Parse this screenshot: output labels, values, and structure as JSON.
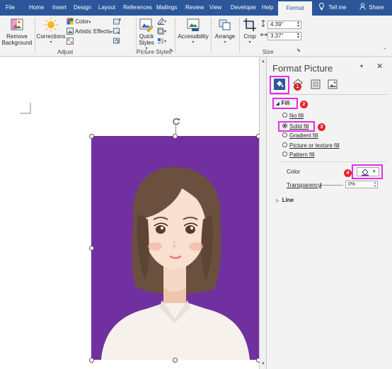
{
  "tabs": [
    "File",
    "Home",
    "Insert",
    "Design",
    "Layout",
    "References",
    "Mailings",
    "Review",
    "View",
    "Developer",
    "Help",
    "Format"
  ],
  "active_tab": "Format",
  "tell_me": "Tell me",
  "share": "Share",
  "ribbon": {
    "remove_background": "Remove Background",
    "corrections": "Corrections",
    "color": "Color",
    "artistic_effects": "Artistic Effects",
    "adjust_label": "Adjust",
    "quick_styles": "Quick Styles",
    "picture_styles_label": "Picture Styles",
    "accessibility": "Accessibility",
    "arrange": "Arrange",
    "crop": "Crop",
    "height": "4.39\"",
    "width": "3.37\"",
    "size_label": "Size"
  },
  "pane": {
    "title": "Format Picture",
    "section_fill": "Fill",
    "options": [
      "No fill",
      "Solid fill",
      "Gradient fill",
      "Picture or texture fill",
      "Pattern fill"
    ],
    "selected_option": "Solid fill",
    "color_label": "Color",
    "transparency_label": "Transparency",
    "transparency_value": "0%",
    "section_line": "Line",
    "badges": [
      "1",
      "2",
      "3",
      "4"
    ]
  },
  "colors": {
    "ribbon_blue": "#2b579a",
    "photo_background": "#7030a0",
    "highlight": "#e52dea",
    "badge": "#e8222e"
  }
}
